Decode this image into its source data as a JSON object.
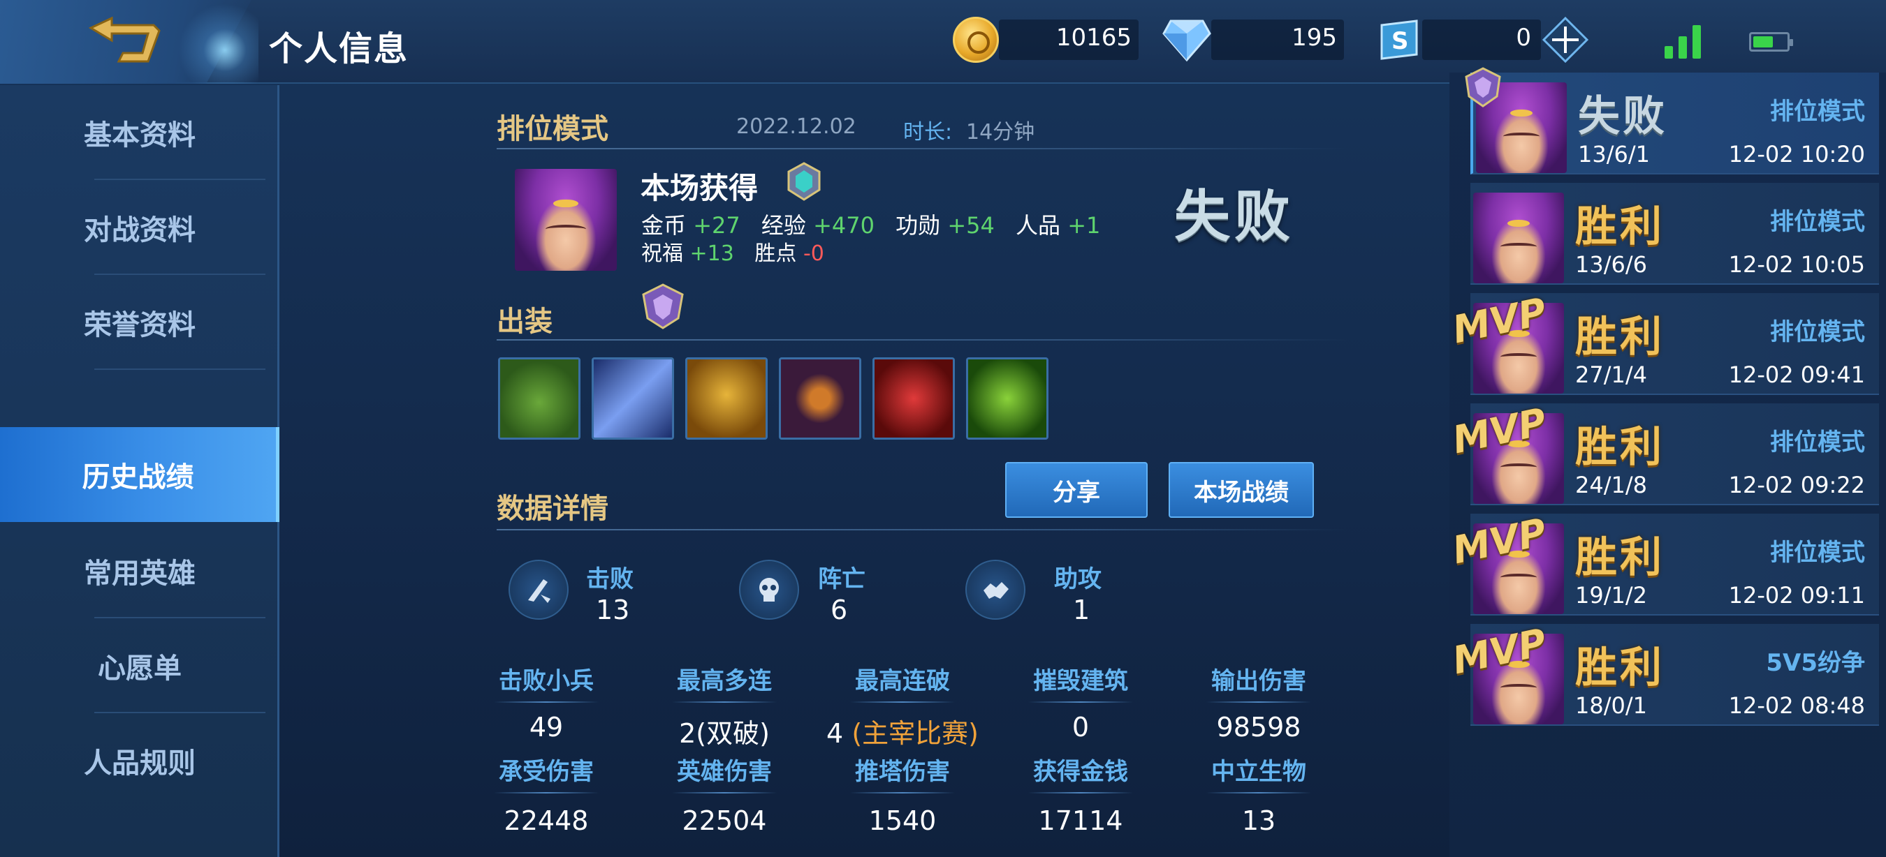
{
  "topbar": {
    "title": "个人信息",
    "back_icon": "back-arrow-icon",
    "gold": "10165",
    "diamond": "195",
    "ticket": "0",
    "plus_icon": "plus-icon",
    "signal_icon": "signal-icon",
    "battery_icon": "battery-icon",
    "battery_level": 0.6
  },
  "sidebar": {
    "items": [
      {
        "label": "基本资料"
      },
      {
        "label": "对战资料"
      },
      {
        "label": "荣誉资料"
      },
      {
        "label": "历史战绩"
      },
      {
        "label": "常用英雄"
      },
      {
        "label": "心愿单"
      },
      {
        "label": "人品规则"
      }
    ],
    "active_index": 3
  },
  "match": {
    "mode": "排位模式",
    "date": "2022.12.02",
    "duration_label": "时长:",
    "duration": "14分钟",
    "gain_title": "本场获得",
    "result": "失败",
    "rewards": {
      "gold_label": "金币",
      "gold": "+27",
      "exp_label": "经验",
      "exp": "+470",
      "merit_label": "功勋",
      "merit": "+54",
      "rp_label": "人品",
      "rp": "+1",
      "bless_label": "祝福",
      "bless": "+13",
      "winpt_label": "胜点",
      "winpt": "-0"
    }
  },
  "build": {
    "title": "出装",
    "items": [
      {
        "icon": "boots-item-icon",
        "colors": [
          "#2d5a1a",
          "#6aa83a"
        ]
      },
      {
        "icon": "blade-item-icon",
        "colors": [
          "#1a2d6a",
          "#7a9ef0"
        ]
      },
      {
        "icon": "mask-item-icon",
        "colors": [
          "#7a4a0a",
          "#e6b43a"
        ]
      },
      {
        "icon": "eye-item-icon",
        "colors": [
          "#3a1a3a",
          "#d07a2a"
        ]
      },
      {
        "icon": "claw-item-icon",
        "colors": [
          "#5a0a0a",
          "#e03a3a"
        ]
      },
      {
        "icon": "orb-item-icon",
        "colors": [
          "#1a4a0a",
          "#8ad23a"
        ]
      }
    ]
  },
  "details": {
    "title": "数据详情",
    "share_label": "分享",
    "record_label": "本场战绩",
    "kills_label": "击败",
    "kills": "13",
    "deaths_label": "阵亡",
    "deaths": "6",
    "assists_label": "助攻",
    "assists": "1",
    "row1": [
      {
        "label": "击败小兵",
        "value": "49"
      },
      {
        "label": "最高多连",
        "value": "2(双破)"
      },
      {
        "label": "最高连破",
        "value": "4",
        "extra": "(主宰比赛)"
      },
      {
        "label": "摧毁建筑",
        "value": "0"
      },
      {
        "label": "输出伤害",
        "value": "98598"
      }
    ],
    "row2": [
      {
        "label": "承受伤害",
        "value": "22448"
      },
      {
        "label": "英雄伤害",
        "value": "22504"
      },
      {
        "label": "推塔伤害",
        "value": "1540"
      },
      {
        "label": "获得金钱",
        "value": "17114"
      },
      {
        "label": "中立生物",
        "value": "13"
      }
    ]
  },
  "history": [
    {
      "result": "失败",
      "win": false,
      "mode": "排位模式",
      "kda": "13/6/1",
      "time": "12-02 10:20",
      "tag": "crest"
    },
    {
      "result": "胜利",
      "win": true,
      "mode": "排位模式",
      "kda": "13/6/6",
      "time": "12-02 10:05",
      "tag": ""
    },
    {
      "result": "胜利",
      "win": true,
      "mode": "排位模式",
      "kda": "27/1/4",
      "time": "12-02 09:41",
      "tag": "MVP"
    },
    {
      "result": "胜利",
      "win": true,
      "mode": "排位模式",
      "kda": "24/1/8",
      "time": "12-02 09:22",
      "tag": "MVP"
    },
    {
      "result": "胜利",
      "win": true,
      "mode": "排位模式",
      "kda": "19/1/2",
      "time": "12-02 09:11",
      "tag": "MVP"
    },
    {
      "result": "胜利",
      "win": true,
      "mode": "5V5纷争",
      "kda": "18/0/1",
      "time": "12-02 08:48",
      "tag": "MVP"
    }
  ]
}
